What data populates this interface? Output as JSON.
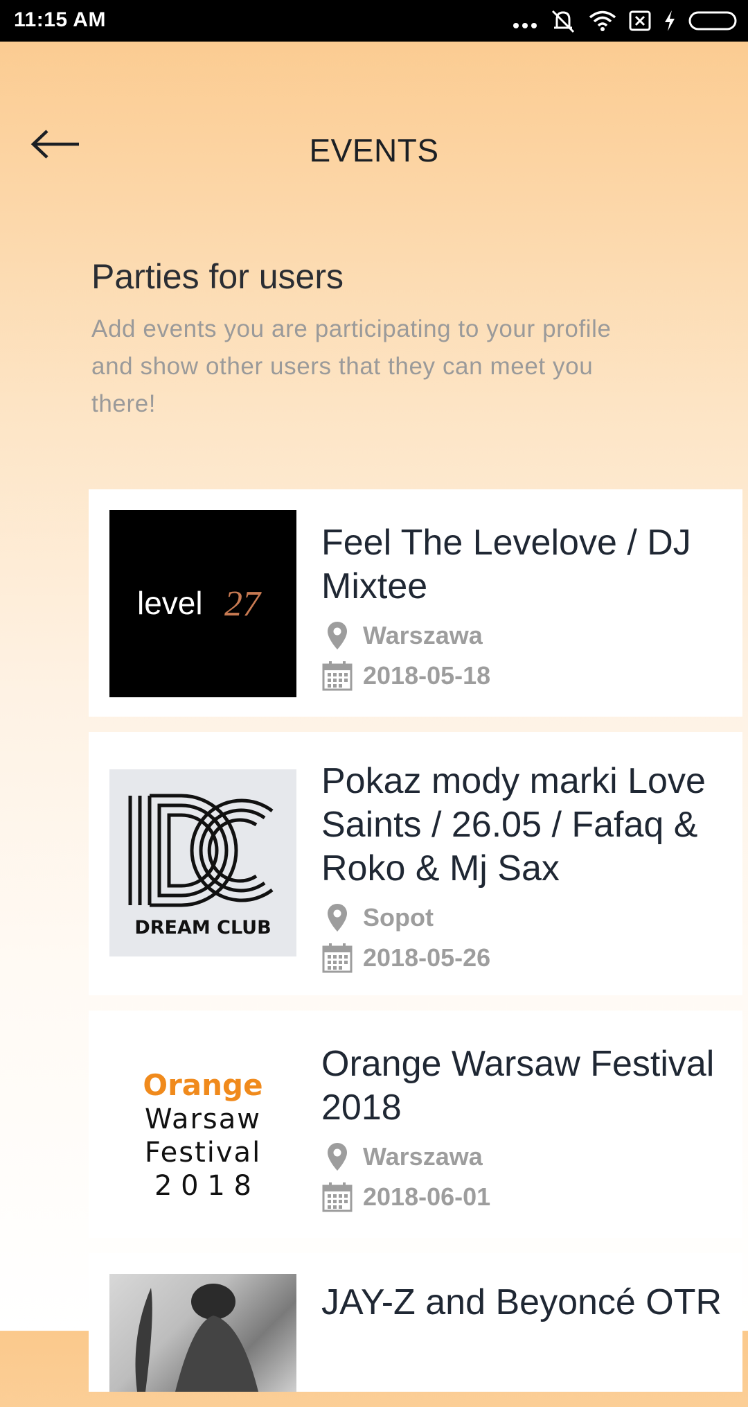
{
  "status_bar": {
    "time": "11:15 AM"
  },
  "header": {
    "title": "EVENTS",
    "back_icon": "arrow-left-icon"
  },
  "intro": {
    "title": "Parties for users",
    "description": "Add events you are participating to your profile and show other users that they can meet you there!"
  },
  "events": [
    {
      "title": "Feel The Levelove / DJ Mixtee",
      "place": "Warszawa",
      "date": "2018-05-18",
      "logo": {
        "word": "level",
        "mark": "27"
      }
    },
    {
      "title": "Pokaz mody marki Love Saints / 26.05 / Fafaq & Roko & Mj Sax",
      "place": "Sopot",
      "date": "2018-05-26",
      "logo": {
        "word": "DREAM CLUB"
      }
    },
    {
      "title": "Orange Warsaw Festival 2018",
      "place": "Warszawa",
      "date": "2018-06-01",
      "logo": {
        "line1": "Orange",
        "line2": "Warsaw",
        "line3": "Festival",
        "line4": "2 0 1 8"
      }
    },
    {
      "title": "JAY-Z and Beyoncé OTR"
    }
  ],
  "colors": {
    "accent_orange": "#f08a1c",
    "title_text": "#1f2733",
    "meta_text": "#9d9d9d"
  }
}
